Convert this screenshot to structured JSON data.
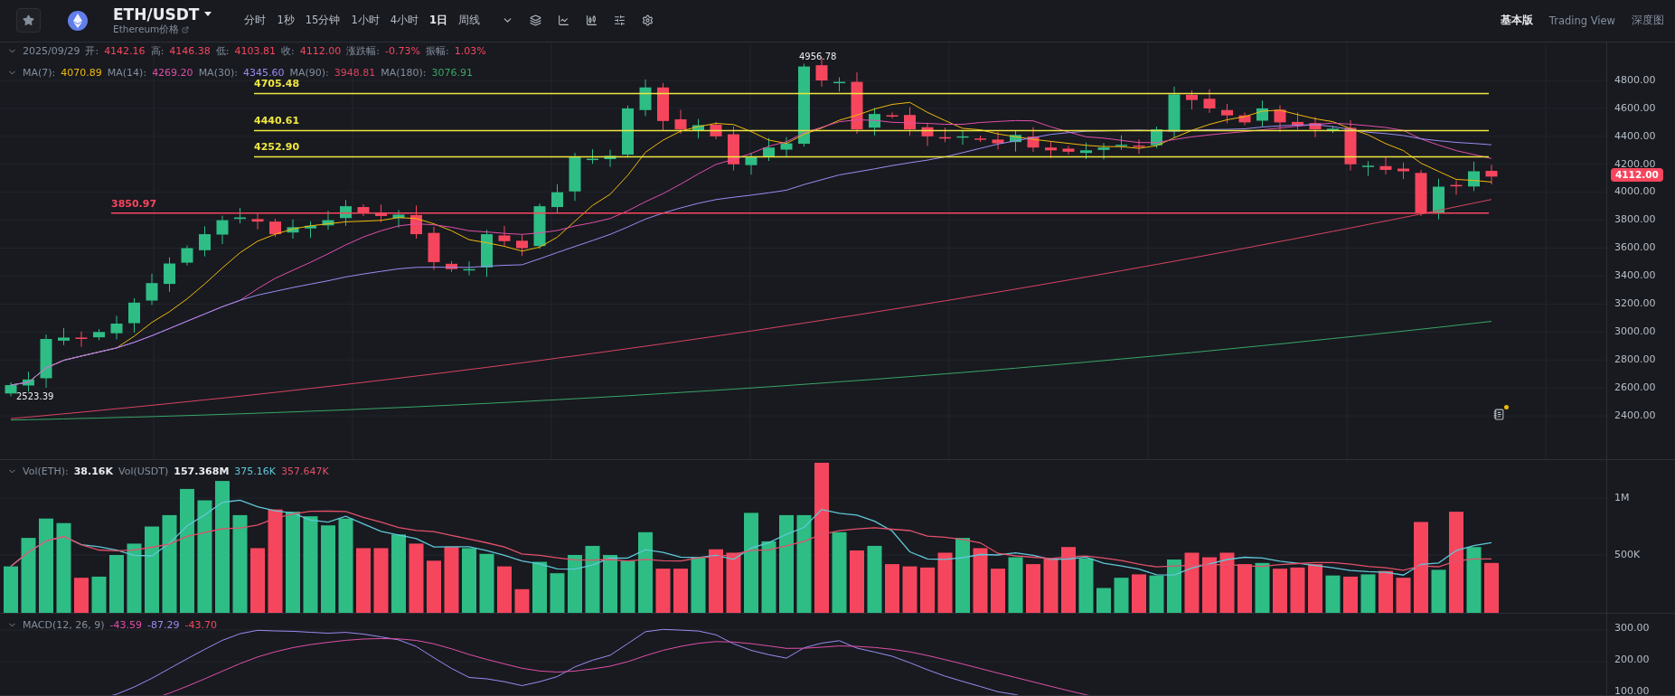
{
  "header": {
    "pair": "ETH/USDT",
    "subtitle": "Ethereum价格",
    "intervals": [
      {
        "label": "分时",
        "selected": false
      },
      {
        "label": "1秒",
        "selected": false
      },
      {
        "label": "15分钟",
        "selected": false
      },
      {
        "label": "1小时",
        "selected": false
      },
      {
        "label": "4小时",
        "selected": false
      },
      {
        "label": "1日",
        "selected": true
      },
      {
        "label": "周线",
        "selected": false
      }
    ],
    "views": [
      {
        "label": "基本版",
        "selected": true
      },
      {
        "label": "Trading View",
        "selected": false
      },
      {
        "label": "深度图",
        "selected": false
      }
    ]
  },
  "ohlc_legend": {
    "date": "2025/09/29",
    "fields": [
      {
        "label": "开:",
        "value": "4142.16"
      },
      {
        "label": "高:",
        "value": "4146.38"
      },
      {
        "label": "低:",
        "value": "4103.81"
      },
      {
        "label": "收:",
        "value": "4112.00"
      },
      {
        "label": "涨跌幅:",
        "value": "-0.73%"
      },
      {
        "label": "振幅:",
        "value": "1.03%"
      }
    ]
  },
  "ma_legend": [
    {
      "label": "MA(7):",
      "value": "4070.89",
      "color": "#f0b90b"
    },
    {
      "label": "MA(14):",
      "value": "4269.20",
      "color": "#e04ea8"
    },
    {
      "label": "MA(30):",
      "value": "4345.60",
      "color": "#9b8cf2"
    },
    {
      "label": "MA(90):",
      "value": "3948.81",
      "color": "#d9435f"
    },
    {
      "label": "MA(180):",
      "value": "3076.91",
      "color": "#3aa667"
    }
  ],
  "price_chart": {
    "axis_ticks": [
      "4800.00",
      "4600.00",
      "4400.00",
      "4200.00",
      "4000.00",
      "3800.00",
      "3600.00",
      "3400.00",
      "3200.00",
      "3000.00",
      "2800.00",
      "2600.00",
      "2400.00"
    ],
    "last_price": "4112.00",
    "high_label": "4956.78",
    "low_label": "2523.39",
    "levels": [
      {
        "value": "4705.48",
        "kind": "resistance"
      },
      {
        "value": "4440.61",
        "kind": "resistance"
      },
      {
        "value": "4252.90",
        "kind": "resistance"
      },
      {
        "value": "3850.97",
        "kind": "support"
      }
    ]
  },
  "volume": {
    "eth_label": "Vol(ETH):",
    "eth_value": "38.16K",
    "usdt_label": "Vol(USDT)",
    "usdt_value": "157.368M",
    "ma_values": [
      {
        "value": "375.16K",
        "color": "#5fc8d8"
      },
      {
        "value": "357.647K",
        "color": "#e2506a"
      }
    ],
    "axis_ticks": [
      "1M",
      "500K"
    ]
  },
  "macd": {
    "label": "MACD(12, 26, 9)",
    "values": [
      {
        "value": "-43.59",
        "color": "#e04ea8"
      },
      {
        "value": "-87.29",
        "color": "#9b8cf2"
      },
      {
        "value": "-43.70",
        "color": "#f6465d"
      }
    ],
    "axis_ticks": [
      "300.00",
      "200.00",
      "100.00"
    ]
  }
}
